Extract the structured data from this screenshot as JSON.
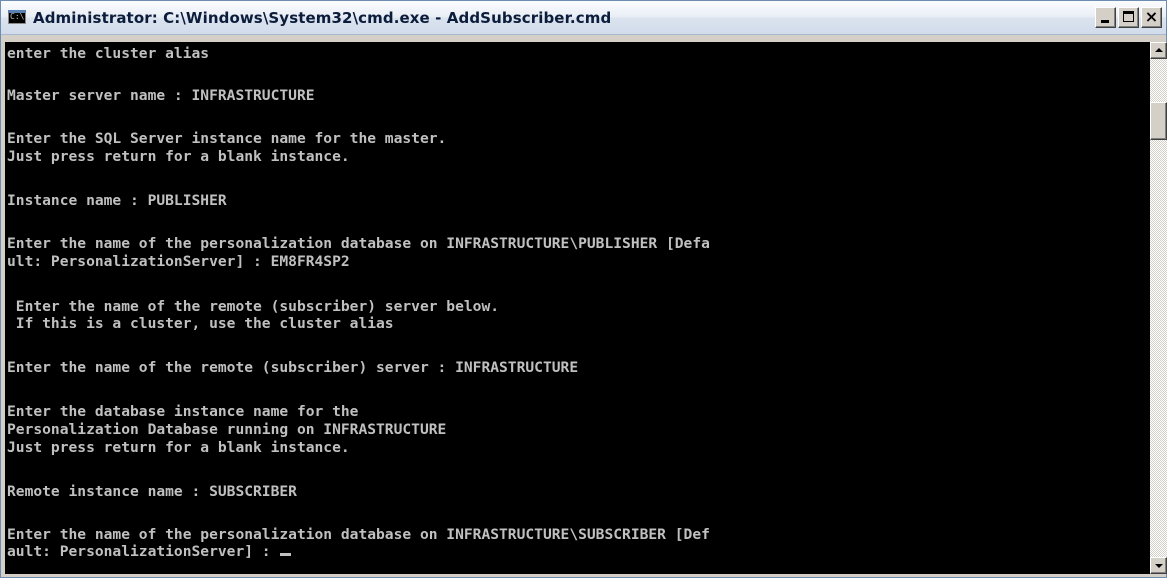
{
  "window": {
    "title": "Administrator: C:\\Windows\\System32\\cmd.exe - AddSubscriber.cmd",
    "icon_label": "C:\\"
  },
  "console": {
    "lines": [
      "enter the cluster alias",
      "Master server name : INFRASTRUCTURE",
      "Enter the SQL Server instance name for the master.",
      "Just press return for a blank instance.",
      "Instance name : PUBLISHER",
      "Enter the name of the personalization database on INFRASTRUCTURE\\PUBLISHER [Defa",
      "ult: PersonalizationServer] : EM8FR4SP2",
      " Enter the name of the remote (subscriber) server below.",
      " If this is a cluster, use the cluster alias",
      "Enter the name of the remote (subscriber) server : INFRASTRUCTURE",
      "Enter the database instance name for the",
      "Personalization Database running on INFRASTRUCTURE",
      "Just press return for a blank instance.",
      "Remote instance name : SUBSCRIBER",
      "Enter the name of the personalization database on INFRASTRUCTURE\\SUBSCRIBER [Def",
      "ault: PersonalizationServer] : "
    ]
  },
  "colors": {
    "console_background": "#000000",
    "console_text": "#c0c0c0"
  }
}
